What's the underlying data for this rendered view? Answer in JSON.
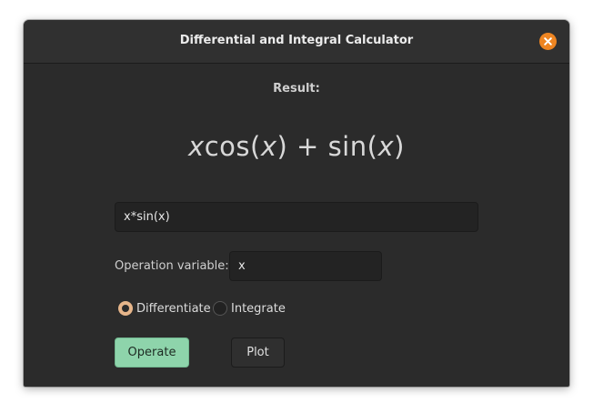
{
  "window": {
    "title": "Differential and Integral Calculator"
  },
  "result": {
    "label": "Result:",
    "expression_parts": [
      "x",
      "cos(",
      "x",
      ") + sin(",
      "x",
      ")"
    ]
  },
  "expression_input": {
    "value": "x*sin(x)"
  },
  "operation_variable": {
    "label": "Operation variable:",
    "value": "x"
  },
  "mode": {
    "options": [
      {
        "label": "Differentiate",
        "selected": true
      },
      {
        "label": "Integrate",
        "selected": false
      }
    ]
  },
  "buttons": {
    "operate_label": "Operate",
    "plot_label": "Plot"
  },
  "colors": {
    "accent_close": "#ee8522",
    "radio_selected": "#e6b58a",
    "operate_button": "#8ed4ab"
  },
  "icons": {
    "close": "close-icon"
  }
}
